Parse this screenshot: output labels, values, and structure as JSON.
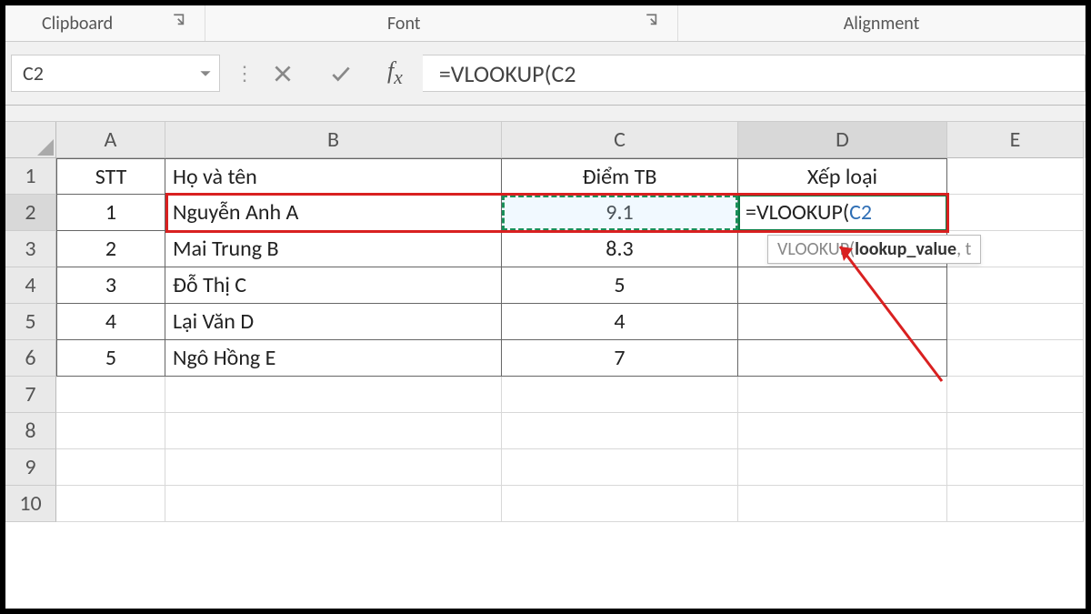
{
  "ribbon": {
    "clipboard_label": "Clipboard",
    "font_label": "Font",
    "alignment_label": "Alignment"
  },
  "name_box": {
    "value": "C2"
  },
  "formula_bar": {
    "value": "=VLOOKUP(C2"
  },
  "columns": {
    "A": "A",
    "B": "B",
    "C": "C",
    "D": "D",
    "E": "E"
  },
  "row_numbers": [
    "1",
    "2",
    "3",
    "4",
    "5",
    "6",
    "7",
    "8",
    "9",
    "10"
  ],
  "table": {
    "headers": {
      "stt": "STT",
      "name": "Họ và tên",
      "score": "Điểm TB",
      "rank": "Xếp loại"
    },
    "rows": [
      {
        "stt": "1",
        "name": "Nguyễn Anh A",
        "score": "9.1",
        "rank_formula_prefix": "=VLOOKUP(",
        "rank_formula_ref": "C2"
      },
      {
        "stt": "2",
        "name": "Mai Trung B",
        "score": "8.3"
      },
      {
        "stt": "3",
        "name": "Đỗ Thị C",
        "score": "5"
      },
      {
        "stt": "4",
        "name": "Lại Văn D",
        "score": "4"
      },
      {
        "stt": "5",
        "name": "Ngô Hồng E",
        "score": "7"
      }
    ]
  },
  "tooltip": {
    "fn": "VLOOKUP(",
    "arg_bold": "lookup_value",
    "rest": ", t"
  }
}
